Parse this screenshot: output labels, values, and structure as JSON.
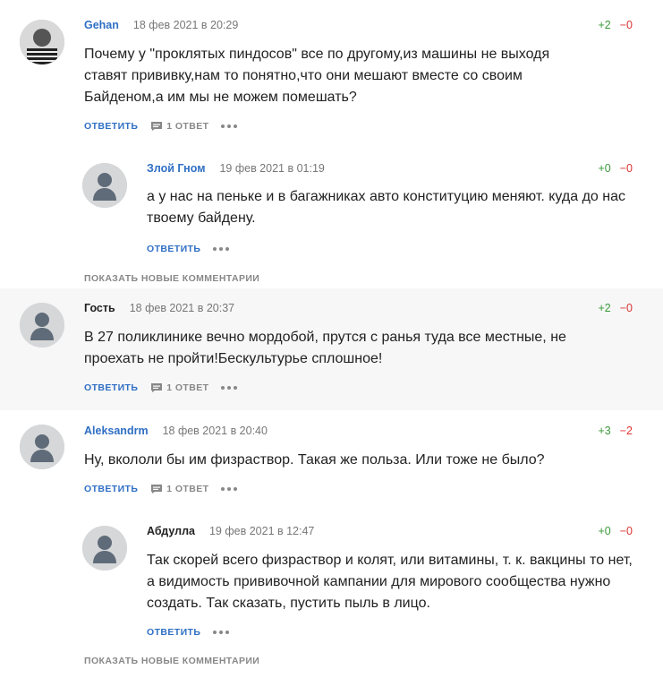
{
  "comments": [
    {
      "author": "Gehan",
      "date": "18 фев 2021 в 20:29",
      "up": "+2",
      "down": "−0",
      "text": "Почему у \"проклятых пиндосов\" все по другому,из машины не выходя ставят прививку,нам то понятно,что они мешают вместе со своим Байденом,а им мы не можем помешать?",
      "reply": "ОТВЕТИТЬ",
      "replies": "1 ОТВЕТ"
    },
    {
      "author": "Злой Гном",
      "date": "19 фев 2021 в 01:19",
      "up": "+0",
      "down": "−0",
      "text": "а у нас на пеньке и в багажниках авто конституцию меняют. куда до нас твоему байдену.",
      "reply": "ОТВЕТИТЬ"
    },
    {
      "author": "Гость",
      "date": "18 фев 2021 в 20:37",
      "up": "+2",
      "down": "−0",
      "text": "В 27 поликлинике вечно мордобой, прутся с ранья туда все местные, не проехать не пройти!Бескультурье сплошное!",
      "reply": "ОТВЕТИТЬ",
      "replies": "1 ОТВЕТ"
    },
    {
      "author": "Aleksandrm",
      "date": "18 фев 2021 в 20:40",
      "up": "+3",
      "down": "−2",
      "text": "Ну, вкололи бы им физраствор. Такая же польза. Или тоже не было?",
      "reply": "ОТВЕТИТЬ",
      "replies": "1 ОТВЕТ"
    },
    {
      "author": "Абдулла",
      "date": "19 фев 2021 в 12:47",
      "up": "+0",
      "down": "−0",
      "text": "Так скорей всего физраствор и колят, или витамины, т. к. вакцины то нет, а видимость прививочной кампании для мирового сообщества нужно создать. Так сказать, пустить пыль в лицо.",
      "reply": "ОТВЕТИТЬ"
    }
  ],
  "show_new": "ПОКАЗАТЬ НОВЫЕ КОММЕНТАРИИ",
  "colors": {
    "link": "#2f6fc4",
    "up": "#3a9a3a",
    "down": "#dd3333",
    "muted": "#888888",
    "shade": "#f7f7f7"
  },
  "icons": {
    "replies": "speech-bubble-icon",
    "more": "more-dots-icon",
    "avatar": "user-silhouette-icon"
  }
}
